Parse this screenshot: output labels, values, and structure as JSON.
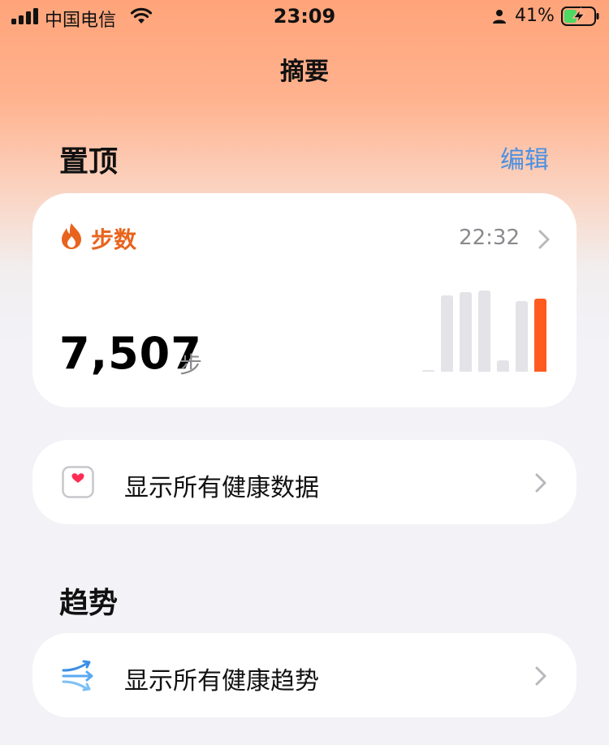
{
  "status_bar": {
    "carrier": "中国电信",
    "time": "23:09",
    "battery_percent": "41%"
  },
  "nav": {
    "title": "摘要"
  },
  "pinned": {
    "section_title": "置顶",
    "edit_label": "编辑",
    "steps_card": {
      "label": "步数",
      "time": "22:32",
      "value": "7,507",
      "unit": "步",
      "accent_color": "#ff5a1f",
      "bar_color": "#e3e3e8",
      "chart_data": {
        "type": "bar",
        "values": [
          0.01,
          0.96,
          1.0,
          1.02,
          0.14,
          0.89,
          0.92
        ],
        "highlighted_index": 6
      }
    }
  },
  "show_all_data": {
    "label": "显示所有健康数据"
  },
  "trends": {
    "section_title": "趋势",
    "show_all_label": "显示所有健康趋势"
  }
}
